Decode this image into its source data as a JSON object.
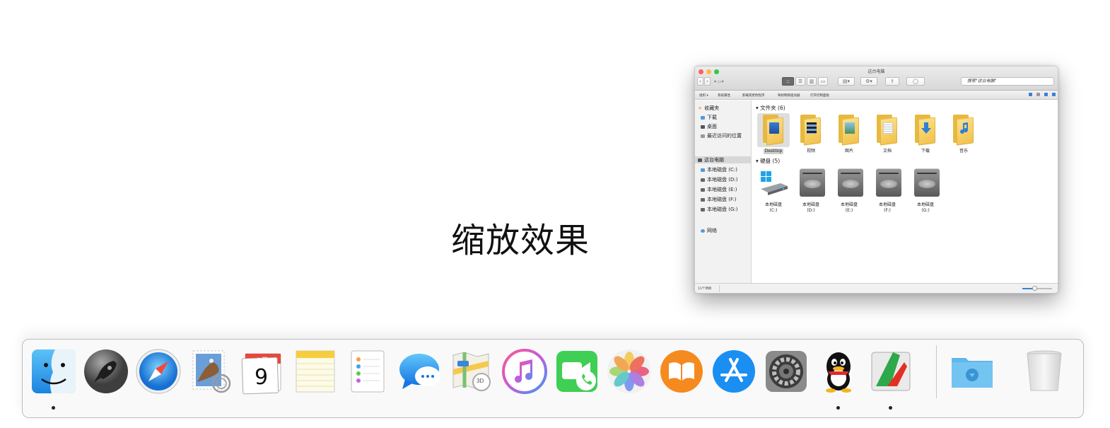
{
  "caption": "缩放效果",
  "finder": {
    "title": "这台电脑",
    "search_placeholder": "搜索\"这台电脑\"",
    "toolbar": {
      "back": "‹",
      "forward": "›",
      "view_icons": "::",
      "view_list": "☰",
      "view_columns": "▥",
      "view_cover": "▭",
      "arrange": "▤▾",
      "action": "⚙▾",
      "share": "⇪",
      "tag": "◯"
    },
    "command_bar": [
      "组织 ▾",
      "系统属性",
      "卸载或更改程序",
      "映射网络驱动器",
      "打开控制面板"
    ],
    "sidebar": {
      "favorites_header": "收藏夹",
      "favorites": [
        "下载",
        "桌面",
        "最近访问的位置"
      ],
      "computer_header": "这台电脑",
      "drives": [
        "本地磁盘 (C:)",
        "本地磁盘 (D:)",
        "本地磁盘 (E:)",
        "本地磁盘 (F:)",
        "本地磁盘 (G:)"
      ],
      "network": "网络"
    },
    "folders_section": "▾ 文件夹 (6)",
    "folders": [
      "Desktop",
      "视频",
      "图片",
      "文档",
      "下载",
      "音乐"
    ],
    "drives_section": "▾ 硬盘 (5)",
    "drives": [
      {
        "name": "本地磁盘",
        "letter": "(C:)"
      },
      {
        "name": "本地磁盘",
        "letter": "(D:)"
      },
      {
        "name": "本地磁盘",
        "letter": "(E:)"
      },
      {
        "name": "本地磁盘",
        "letter": "(F:)"
      },
      {
        "name": "本地磁盘",
        "letter": "(G:)"
      }
    ],
    "status": "11个项目",
    "zoom_level": 0.4
  },
  "dock": {
    "apps": [
      {
        "name": "finder-icon",
        "running": true
      },
      {
        "name": "launchpad-icon",
        "running": false
      },
      {
        "name": "safari-icon",
        "running": false
      },
      {
        "name": "mail-icon",
        "running": false
      },
      {
        "name": "calendar-icon",
        "running": false,
        "month": "5月",
        "day": "9"
      },
      {
        "name": "notes-icon",
        "running": false
      },
      {
        "name": "reminders-icon",
        "running": false
      },
      {
        "name": "messages-icon",
        "running": false
      },
      {
        "name": "maps-icon",
        "running": false,
        "badge": "3D"
      },
      {
        "name": "itunes-icon",
        "running": false
      },
      {
        "name": "facetime-icon",
        "running": false
      },
      {
        "name": "photos-icon",
        "running": false
      },
      {
        "name": "ibooks-icon",
        "running": false
      },
      {
        "name": "app-store-icon",
        "running": false
      },
      {
        "name": "system-preferences-icon",
        "running": false
      },
      {
        "name": "qq-icon",
        "running": true
      },
      {
        "name": "crossover-icon",
        "running": true
      },
      {
        "name": "downloads-folder-icon",
        "running": false
      },
      {
        "name": "trash-icon",
        "running": false
      }
    ]
  }
}
